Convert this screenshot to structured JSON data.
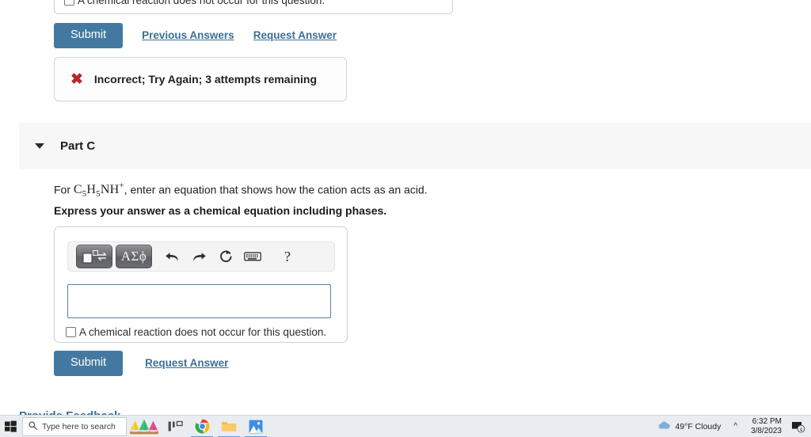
{
  "part_b": {
    "checkbox_label": "A chemical reaction does not occur for this question.",
    "submit_label": "Submit",
    "previous_answers_label": "Previous Answers",
    "request_answer_label": "Request Answer",
    "feedback": {
      "icon": "x-mark-icon",
      "text": "Incorrect; Try Again; 3 attempts remaining",
      "icon_color": "#b8262c"
    }
  },
  "part_c": {
    "title": "Part C",
    "caret_icon": "chevron-down-icon",
    "question_prefix": "For ",
    "formula": {
      "element1": "C",
      "sub1": "5",
      "element2": "H",
      "sub2": "5",
      "element3": "NH",
      "charge": "+"
    },
    "question_suffix": ", enter an equation that shows how the cation acts as an acid.",
    "instruction": "Express your answer as a chemical equation including phases.",
    "toolbar": {
      "template_button": "equation-template-icon",
      "greek_button": "ΑΣϕ",
      "undo_icon": "undo-arrow-icon",
      "redo_icon": "redo-arrow-icon",
      "reset_icon": "reset-circular-arrow-icon",
      "keyboard_icon": "keyboard-icon",
      "help_icon": "?"
    },
    "answer_value": "",
    "checkbox_label": "A chemical reaction does not occur for this question.",
    "checkbox_checked": false,
    "submit_label": "Submit",
    "request_answer_label": "Request Answer"
  },
  "page_footer": {
    "feedback_link": "Provide Feedback"
  },
  "taskbar": {
    "start_icon": "windows-start-icon",
    "search_icon": "search-icon",
    "search_placeholder": "Type here to search",
    "cortana_icon": "cortana-cones-icon",
    "taskview_icon": "task-view-icon",
    "chrome_icon": "chrome-icon",
    "explorer_icon": "file-explorer-icon",
    "photos_icon": "photos-icon",
    "weather_icon": "cloud-icon",
    "weather_text": "49°F  Cloudy",
    "chevron_icon": "chevron-up-icon",
    "time": "6:32 PM",
    "date": "3/8/2023",
    "notification_icon": "notification-icon",
    "notification_count": "4"
  },
  "colors": {
    "accent_blue": "#4379a0",
    "link_blue": "#3d6e94",
    "error_red": "#b8262c",
    "header_gray": "#f7f7f7"
  }
}
